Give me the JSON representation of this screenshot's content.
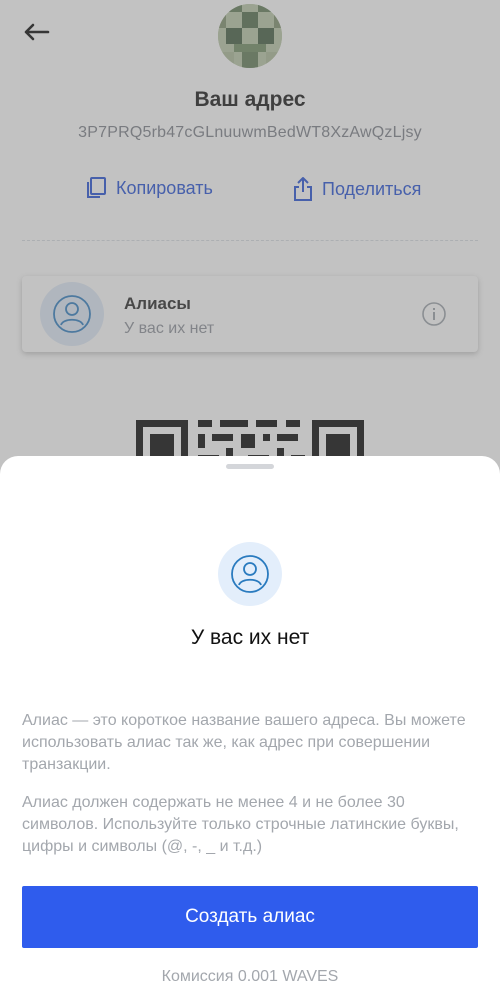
{
  "header": {
    "title": "Ваш адрес",
    "address": "3P7PRQ5rb47cGLnuuwmBedWT8XzAwQzLjsy"
  },
  "actions": {
    "copy_label": "Копировать",
    "share_label": "Поделиться"
  },
  "alias_card": {
    "title": "Алиасы",
    "subtitle": "У вас их нет"
  },
  "sheet": {
    "title": "У вас их нет",
    "paragraph1": "Алиас — это короткое название вашего адреса. Вы можете использовать алиас так же, как адрес при совершении транзакции.",
    "paragraph2": "Алиас должен содержать не менее 4 и не более 30 символов. Используйте только строчные латинские буквы, цифры и символы (@, -, _ и т.д.)",
    "create_button": "Создать алиас",
    "fee": "Комиссия 0.001 WAVES"
  },
  "colors": {
    "accent": "#2f5ced",
    "link": "#1f4dd6",
    "muted_text": "#a3a7ad"
  },
  "icons": [
    "back-arrow-icon",
    "copy-icon",
    "share-icon",
    "user-icon",
    "info-icon"
  ]
}
